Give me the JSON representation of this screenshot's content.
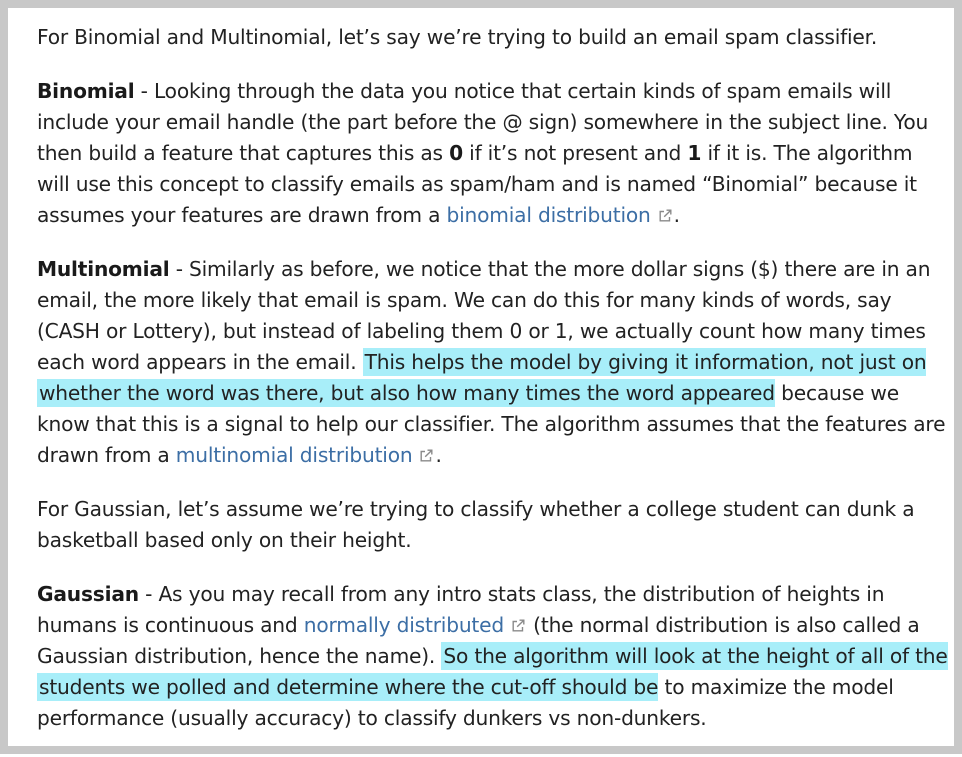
{
  "intro": "For Binomial and Multinomial, let’s say we’re trying to build an email spam classifier.",
  "binomial": {
    "term": "Binomial",
    "text1": " - Looking through the data you notice that certain kinds of spam emails will include your email handle (the part before the @ sign) somewhere in the subject line. You then build a feature that captures this as ",
    "bold0": "0",
    "text2": " if it’s not present and ",
    "bold1": "1",
    "text3": " if it is. The algorithm will use this concept to classify emails as spam/ham and is named “Binomial” because it assumes your features are drawn from a ",
    "link": "binomial distribution",
    "end": "."
  },
  "multinomial": {
    "term": "Multinomial",
    "text1": " - Similarly as before, we notice that the more dollar signs ($) there are in an email, the more likely that email is spam. We can do this for many kinds of words, say (CASH or Lottery), but instead of labeling them 0 or 1, we actually count how many times each word appears in the email. ",
    "highlight": "This helps the model by giving it information, not just on whether the word was there, but also how many times the word appeared",
    "text2": " because we know that this is a signal to help our classifier. The algorithm assumes that the features are drawn from a ",
    "link": "multinomial distribution",
    "end": "."
  },
  "gaussian_intro": "For Gaussian, let’s assume we’re trying to classify whether a college student can dunk a basketball based only on their height.",
  "gaussian": {
    "term": "Gaussian",
    "text1": " - As you may recall from any intro stats class, the distribution of heights in humans is continuous and ",
    "link": "normally distributed",
    "text2": " (the normal distribution is also called a Gaussian distribution, hence the name). ",
    "highlight": "So the algorithm will look at the height of all of the students we polled and determine where the cut-off should be",
    "text3": " to maximize the model performance (usually accuracy) to classify dunkers vs non-dunkers."
  },
  "icons": {
    "external_link": "external-link-icon"
  },
  "colors": {
    "highlight": "#a8eef9",
    "link": "#3c6ea5",
    "text": "#222222",
    "border": "#c8c8c8"
  }
}
